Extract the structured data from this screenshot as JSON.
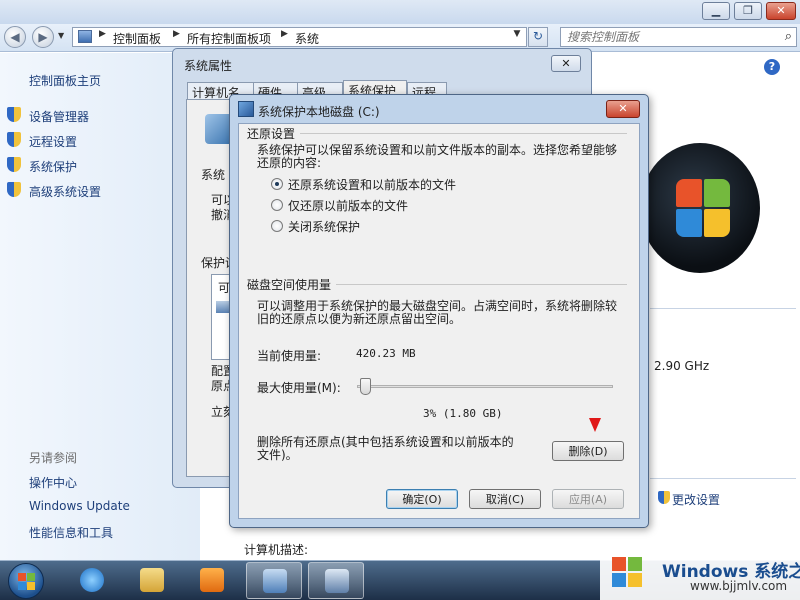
{
  "breadcrumb": [
    "控制面板",
    "所有控制面板项",
    "系统"
  ],
  "search": {
    "placeholder": "搜索控制面板"
  },
  "left_pane": {
    "home": "控制面板主页",
    "tasks": [
      "设备管理器",
      "远程设置",
      "系统保护",
      "高级系统设置"
    ],
    "see_also_title": "另请参阅",
    "see_also": [
      "操作中心",
      "Windows Update",
      "性能信息和工具"
    ]
  },
  "system_info": {
    "cpu_speed": "2.90 GHz",
    "change_settings": "更改设置",
    "computer_description_label": "计算机描述:"
  },
  "system_properties": {
    "title": "系统属性",
    "close": "✕",
    "tabs": [
      "计算机名",
      "硬件",
      "高级",
      "系统保护",
      "远程"
    ],
    "fragments": [
      "系统",
      "可以",
      "撤消",
      "保护设",
      "可",
      "配置",
      "原点",
      "立刻"
    ]
  },
  "restore_dialog": {
    "title": "系统保护本地磁盘 (C:)",
    "restore_settings": {
      "title": "还原设置",
      "description": "系统保护可以保留系统设置和以前文件版本的副本。选择您希望能够\n还原的内容:",
      "options": [
        {
          "label": "还原系统设置和以前版本的文件",
          "selected": true
        },
        {
          "label": "仅还原以前版本的文件",
          "selected": false
        },
        {
          "label": "关闭系统保护",
          "selected": false
        }
      ]
    },
    "disk_usage": {
      "title": "磁盘空间使用量",
      "description": "可以调整用于系统保护的最大磁盘空间。占满空间时，系统将删除较\n旧的还原点以便为新还原点留出空间。",
      "current_usage_label": "当前使用量:",
      "current_usage_value": "420.23 MB",
      "max_usage_label": "最大使用量(M):",
      "slider_value_percent": 3,
      "slider_readout": "3% (1.80 GB)"
    },
    "delete_text": "删除所有还原点(其中包括系统设置和以前版本的\n文件)。",
    "delete_button": "删除(D)",
    "ok_button": "确定(O)",
    "cancel_button": "取消(C)",
    "apply_button": "应用(A)"
  },
  "watermark": {
    "brand": "Windows 系统之家",
    "url": "www.bjjmlv.com"
  },
  "colors": {
    "link": "#1e3f7a",
    "titlebar": "#c9d9ee",
    "taskbar": "#1d2f47",
    "arrow": "#e01818"
  }
}
